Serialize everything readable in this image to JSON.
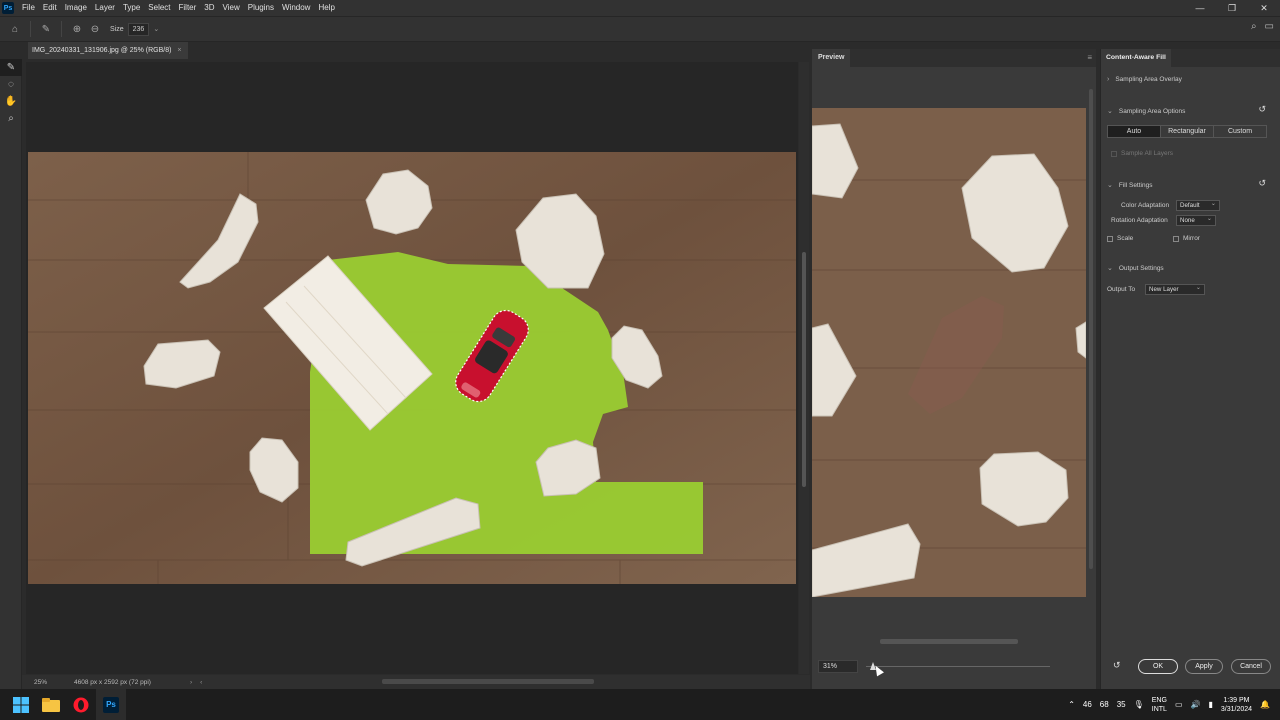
{
  "app": {
    "logo": "Ps"
  },
  "menu": [
    "File",
    "Edit",
    "Image",
    "Layer",
    "Type",
    "Select",
    "Filter",
    "3D",
    "View",
    "Plugins",
    "Window",
    "Help"
  ],
  "window_controls": [
    "—",
    "❐",
    "✕"
  ],
  "options": {
    "size_label": "Size",
    "size_value": "236"
  },
  "document": {
    "tab_title": "IMG_20240331_131906.jpg @ 25% (RGB/8)",
    "zoom": "25%",
    "dimensions": "4608 px x 2592 px (72 ppi)"
  },
  "preview": {
    "title": "Preview",
    "zoom": "31%"
  },
  "panel": {
    "title": "Content-Aware Fill",
    "sampling_overlay": "Sampling Area Overlay",
    "sampling_options": "Sampling Area Options",
    "modes": [
      "Auto",
      "Rectangular",
      "Custom"
    ],
    "active_mode": "Auto",
    "sample_all_layers": "Sample All Layers",
    "fill_settings": "Fill Settings",
    "color_adaptation_label": "Color Adaptation",
    "color_adaptation_value": "Default",
    "rotation_adaptation_label": "Rotation Adaptation",
    "rotation_adaptation_value": "None",
    "scale_label": "Scale",
    "mirror_label": "Mirror",
    "output_settings": "Output Settings",
    "output_to_label": "Output To",
    "output_to_value": "New Layer",
    "ok": "OK",
    "apply": "Apply",
    "cancel": "Cancel"
  },
  "taskbar": {
    "tray_numbers": [
      "46",
      "68",
      "35"
    ],
    "lang": "ENG",
    "lang_sub": "INTL",
    "time": "1:39 PM",
    "date": "3/31/2024"
  },
  "colors": {
    "accent": "#31a8ff",
    "selection_overlay": "#9acd32",
    "car_red": "#c8102e",
    "wood": "#7a5c45"
  }
}
